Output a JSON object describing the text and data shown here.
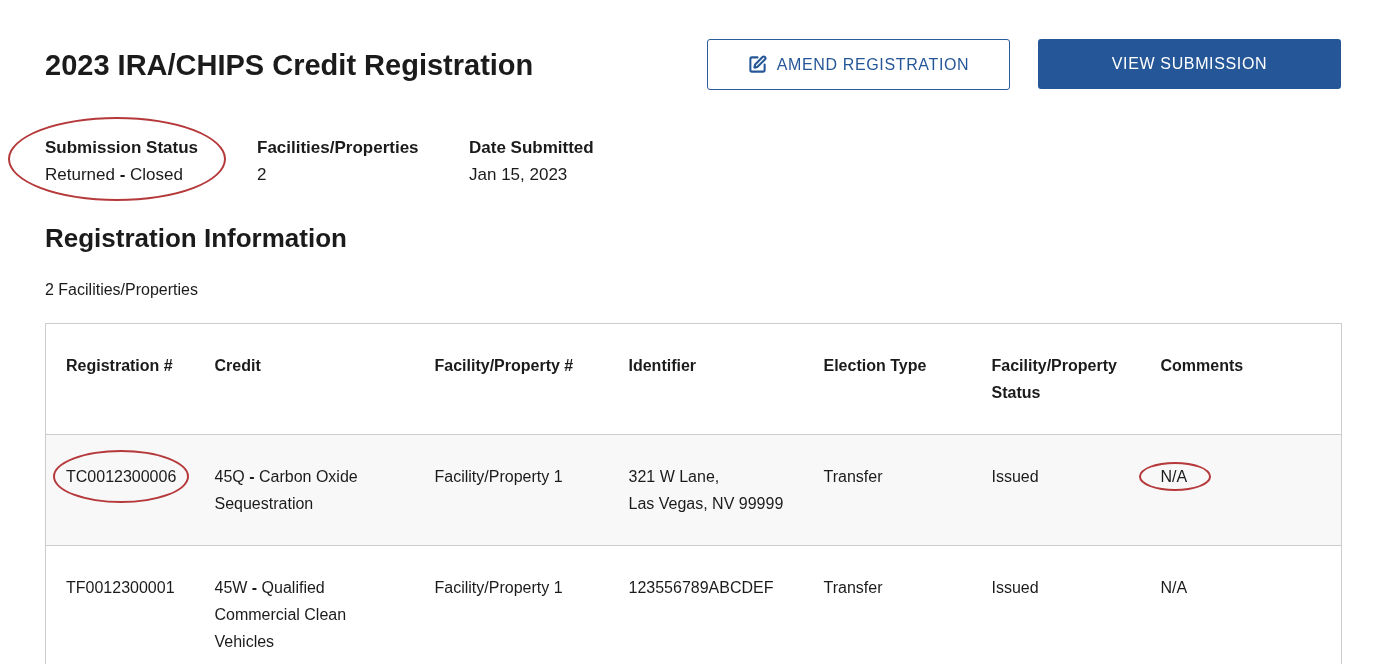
{
  "page": {
    "title": "2023 IRA/CHIPS Credit Registration"
  },
  "actions": [
    {
      "label": "AMEND REGISTRATION",
      "kind": "outline"
    },
    {
      "label": "VIEW SUBMISSION",
      "kind": "primary"
    }
  ],
  "summary": [
    {
      "label": "Submission Status",
      "value": "Returned **-** Closed",
      "circled": true
    },
    {
      "label": "Facilities/Properties",
      "value": "2",
      "circled": false
    },
    {
      "label": "Date Submitted",
      "value": "Jan 15, 2023",
      "circled": false
    }
  ],
  "registration": {
    "heading": "Registration Information",
    "count": "2 Facilities/Properties"
  },
  "table": {
    "columns": [
      "Registration #",
      "Credit",
      "Facility/Property #",
      "Identifier",
      "Election Type",
      "Facility/Property Status",
      "Comments"
    ],
    "rows": [
      {
        "cells": [
          {
            "text": "TC0012300006",
            "circled": true
          },
          {
            "text": "45Q **-** Carbon Oxide Sequestration",
            "circled": false
          },
          {
            "text": "Facility/Property 1",
            "circled": false
          },
          {
            "text": "321 W Lane,\nLas Vegas, NV 99999",
            "circled": false
          },
          {
            "text": "Transfer",
            "circled": false
          },
          {
            "text": "Issued",
            "circled": false
          },
          {
            "text": "N/A",
            "circled": true
          }
        ]
      },
      {
        "cells": [
          {
            "text": "TF0012300001",
            "circled": false
          },
          {
            "text": "45W **-** Qualified Commercial Clean Vehicles",
            "circled": false
          },
          {
            "text": "Facility/Property 1",
            "circled": false
          },
          {
            "text": "123556789ABCDEF",
            "circled": false
          },
          {
            "text": "Transfer",
            "circled": false
          },
          {
            "text": "Issued",
            "circled": false
          },
          {
            "text": "N/A",
            "circled": false
          }
        ]
      }
    ]
  }
}
